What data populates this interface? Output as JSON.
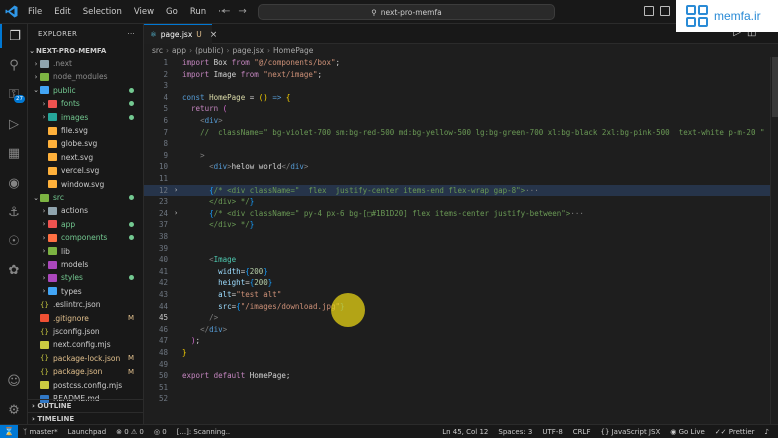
{
  "titlebar": {
    "menu": [
      "File",
      "Edit",
      "Selection",
      "View",
      "Go",
      "Run",
      "···"
    ],
    "search_text": "next-pro-memfa"
  },
  "watermark": {
    "text": "memfa.ir"
  },
  "activity": {
    "source_control_badge": "27"
  },
  "sidebar": {
    "title": "EXPLORER",
    "project": "NEXT-PRO-MEMFA",
    "tree": [
      {
        "label": ".next",
        "depth": 1,
        "kind": "folder",
        "collapsed": true,
        "status": "gray"
      },
      {
        "label": "node_modules",
        "depth": 1,
        "kind": "folder",
        "collapsed": true,
        "status": "gray"
      },
      {
        "label": "public",
        "depth": 1,
        "kind": "folder",
        "collapsed": false,
        "status": "green",
        "dot": true
      },
      {
        "label": "fonts",
        "depth": 2,
        "kind": "folder",
        "collapsed": true,
        "status": "green",
        "dot": true
      },
      {
        "label": "images",
        "depth": 2,
        "kind": "folder",
        "collapsed": true,
        "status": "green",
        "dot": true
      },
      {
        "label": "file.svg",
        "depth": 2,
        "kind": "svg"
      },
      {
        "label": "globe.svg",
        "depth": 2,
        "kind": "svg"
      },
      {
        "label": "next.svg",
        "depth": 2,
        "kind": "svg"
      },
      {
        "label": "vercel.svg",
        "depth": 2,
        "kind": "svg"
      },
      {
        "label": "window.svg",
        "depth": 2,
        "kind": "svg"
      },
      {
        "label": "src",
        "depth": 1,
        "kind": "folder",
        "collapsed": false,
        "status": "green",
        "dot": true
      },
      {
        "label": "actions",
        "depth": 2,
        "kind": "folder",
        "collapsed": true
      },
      {
        "label": "app",
        "depth": 2,
        "kind": "folder",
        "collapsed": true,
        "status": "green",
        "dot": true
      },
      {
        "label": "components",
        "depth": 2,
        "kind": "folder",
        "collapsed": true,
        "status": "green",
        "dot": true
      },
      {
        "label": "lib",
        "depth": 2,
        "kind": "folder",
        "collapsed": true
      },
      {
        "label": "models",
        "depth": 2,
        "kind": "folder",
        "collapsed": true
      },
      {
        "label": "styles",
        "depth": 2,
        "kind": "folder",
        "collapsed": true,
        "status": "green",
        "dot": true
      },
      {
        "label": "types",
        "depth": 2,
        "kind": "folder",
        "collapsed": true
      },
      {
        "label": ".eslintrc.json",
        "depth": 1,
        "kind": "json"
      },
      {
        "label": ".gitignore",
        "depth": 1,
        "kind": "git",
        "status": "mod",
        "mark": "M"
      },
      {
        "label": "jsconfig.json",
        "depth": 1,
        "kind": "json"
      },
      {
        "label": "next.config.mjs",
        "depth": 1,
        "kind": "js"
      },
      {
        "label": "package-lock.json",
        "depth": 1,
        "kind": "json",
        "status": "mod",
        "mark": "M"
      },
      {
        "label": "package.json",
        "depth": 1,
        "kind": "json",
        "status": "mod",
        "mark": "M"
      },
      {
        "label": "postcss.config.mjs",
        "depth": 1,
        "kind": "js"
      },
      {
        "label": "README.md",
        "depth": 1,
        "kind": "md"
      }
    ],
    "outline": "OUTLINE",
    "timeline": "TIMELINE"
  },
  "editor": {
    "tab": {
      "label": "page.jsx",
      "status": "U"
    },
    "breadcrumb": [
      "src",
      "app",
      "(public)",
      "page.jsx",
      "HomePage"
    ],
    "lines": [
      {
        "n": "1",
        "segs": [
          [
            "k",
            "import "
          ],
          [
            "w",
            "Box "
          ],
          [
            "k",
            "from "
          ],
          [
            "s",
            "\"@/components/box\""
          ],
          [
            "w",
            ";"
          ]
        ]
      },
      {
        "n": "2",
        "segs": [
          [
            "k",
            "import "
          ],
          [
            "w",
            "Image "
          ],
          [
            "k",
            "from "
          ],
          [
            "s",
            "\"next/image\""
          ],
          [
            "w",
            ";"
          ]
        ]
      },
      {
        "n": "3",
        "segs": []
      },
      {
        "n": "4",
        "segs": [
          [
            "kb",
            "const "
          ],
          [
            "f",
            "HomePage "
          ],
          [
            "w",
            "= "
          ],
          [
            "br",
            "()"
          ],
          [
            "w",
            " "
          ],
          [
            "kb",
            "=>"
          ],
          [
            "w",
            " "
          ],
          [
            "br",
            "{"
          ]
        ]
      },
      {
        "n": "5",
        "segs": [
          [
            "w",
            "  "
          ],
          [
            "k",
            "return "
          ],
          [
            "br2",
            "("
          ]
        ]
      },
      {
        "n": "6",
        "segs": [
          [
            "w",
            "    "
          ],
          [
            "p",
            "<"
          ],
          [
            "tg",
            "div"
          ],
          [
            "p",
            ">"
          ]
        ]
      },
      {
        "n": "7",
        "segs": [
          [
            "w",
            "    "
          ],
          [
            "c",
            "//  className=\" bg-violet-700 sm:bg-red-500 md:bg-yellow-500 lg:bg-green-700 xl:bg-black 2xl:bg-pink-500  text-white p-m-20 \""
          ]
        ]
      },
      {
        "n": "8",
        "segs": []
      },
      {
        "n": "9",
        "segs": [
          [
            "w",
            "    "
          ],
          [
            "p",
            ">"
          ]
        ]
      },
      {
        "n": "10",
        "segs": [
          [
            "w",
            "      "
          ],
          [
            "p",
            "<"
          ],
          [
            "tg",
            "div"
          ],
          [
            "p",
            ">"
          ],
          [
            "w",
            "helow world"
          ],
          [
            "p",
            "</"
          ],
          [
            "tg",
            "div"
          ],
          [
            "p",
            ">"
          ]
        ]
      },
      {
        "n": "11",
        "segs": []
      },
      {
        "n": "12",
        "fold": true,
        "hl": true,
        "segs": [
          [
            "w",
            "      "
          ],
          [
            "br3",
            "{"
          ],
          [
            "c",
            "/* <div className=\"  flex  justify-center items-end flex-wrap gap-8\">"
          ],
          [
            "p",
            "···"
          ]
        ]
      },
      {
        "n": "23",
        "segs": [
          [
            "w",
            "      "
          ],
          [
            "c",
            "</div> */"
          ],
          [
            "br3",
            "}"
          ]
        ]
      },
      {
        "n": "24",
        "fold": true,
        "segs": [
          [
            "w",
            "      "
          ],
          [
            "br3",
            "{"
          ],
          [
            "c",
            "/* <div className=\" py-4 px-6 bg-[□#1B1D20] flex items-center justify-between\">"
          ],
          [
            "p",
            "···"
          ]
        ]
      },
      {
        "n": "37",
        "segs": [
          [
            "w",
            "      "
          ],
          [
            "c",
            "</div> */"
          ],
          [
            "br3",
            "}"
          ]
        ]
      },
      {
        "n": "38",
        "segs": []
      },
      {
        "n": "39",
        "segs": []
      },
      {
        "n": "40",
        "segs": [
          [
            "w",
            "      "
          ],
          [
            "p",
            "<"
          ],
          [
            "t",
            "Image"
          ]
        ]
      },
      {
        "n": "41",
        "segs": [
          [
            "w",
            "        "
          ],
          [
            "v",
            "width"
          ],
          [
            "w",
            "="
          ],
          [
            "br3",
            "{"
          ],
          [
            "n",
            "200"
          ],
          [
            "br3",
            "}"
          ]
        ]
      },
      {
        "n": "42",
        "segs": [
          [
            "w",
            "        "
          ],
          [
            "v",
            "height"
          ],
          [
            "w",
            "="
          ],
          [
            "br3",
            "{"
          ],
          [
            "n",
            "200"
          ],
          [
            "br3",
            "}"
          ]
        ]
      },
      {
        "n": "43",
        "segs": [
          [
            "w",
            "        "
          ],
          [
            "v",
            "alt"
          ],
          [
            "w",
            "="
          ],
          [
            "s",
            "\"test alt\""
          ]
        ]
      },
      {
        "n": "44",
        "segs": [
          [
            "w",
            "        "
          ],
          [
            "v",
            "src"
          ],
          [
            "w",
            "="
          ],
          [
            "br3",
            "{"
          ],
          [
            "s",
            "\"/images/download.jpg\""
          ],
          [
            "br3",
            "}"
          ]
        ]
      },
      {
        "n": "45",
        "cur": true,
        "segs": [
          [
            "w",
            "      "
          ],
          [
            "p",
            "/>"
          ]
        ]
      },
      {
        "n": "46",
        "segs": [
          [
            "w",
            "    "
          ],
          [
            "p",
            "</"
          ],
          [
            "tg",
            "div"
          ],
          [
            "p",
            ">"
          ]
        ]
      },
      {
        "n": "47",
        "segs": [
          [
            "w",
            "  "
          ],
          [
            "br2",
            ")"
          ],
          [
            "w",
            ";"
          ]
        ]
      },
      {
        "n": "48",
        "segs": [
          [
            "br",
            "}"
          ]
        ]
      },
      {
        "n": "49",
        "segs": []
      },
      {
        "n": "50",
        "segs": [
          [
            "k",
            "export "
          ],
          [
            "k",
            "default "
          ],
          [
            "w",
            "HomePage;"
          ]
        ]
      },
      {
        "n": "51",
        "segs": []
      },
      {
        "n": "52",
        "segs": []
      }
    ]
  },
  "statusbar": {
    "branch": "master*",
    "launchpad": "Launchpad",
    "problems": "⊗ 0 ⚠ 0",
    "ports": "◎ 0",
    "scanning": "[...]: Scanning..",
    "position": "Ln 45, Col 12",
    "spaces": "Spaces: 3",
    "encoding": "UTF-8",
    "eol": "CRLF",
    "language": "{} JavaScript JSX",
    "golive": "Go Live",
    "prettier": "Prettier"
  }
}
